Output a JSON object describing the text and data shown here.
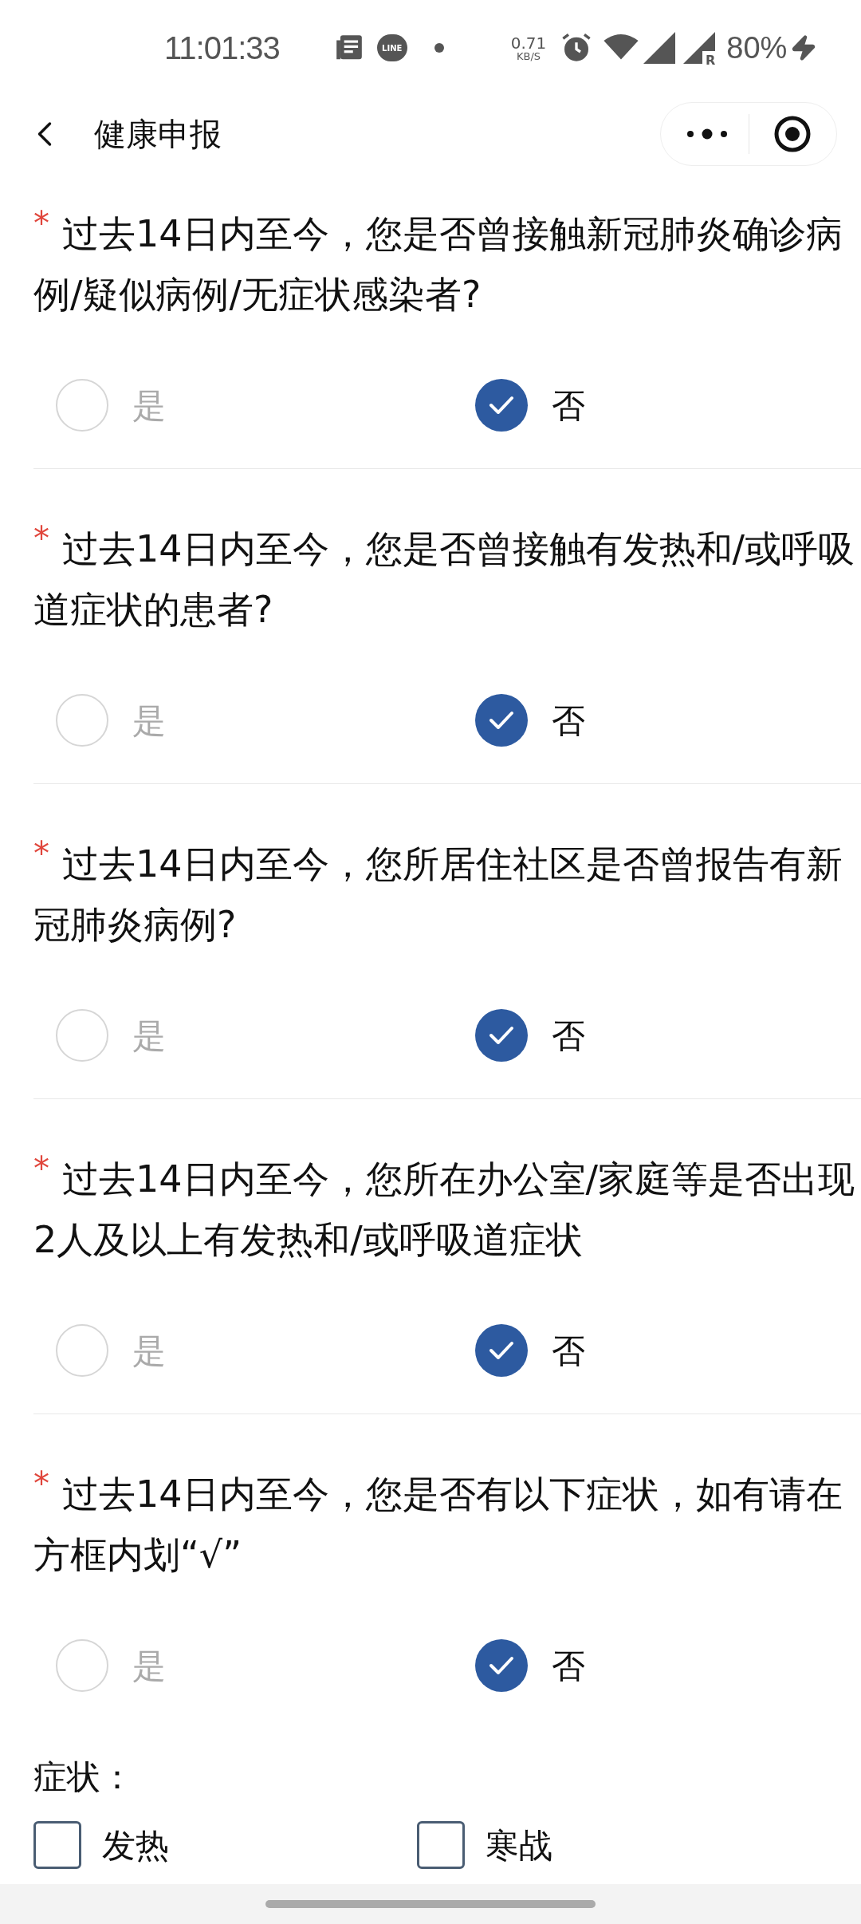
{
  "status_bar": {
    "time": "11:01:33",
    "app_badge": "LINE",
    "speed_value": "0.71",
    "speed_unit": "KB/S",
    "signal_tag": "R",
    "battery": "80%"
  },
  "header": {
    "title": "健康申报"
  },
  "questions": [
    {
      "required_mark": "*",
      "text": "过去14日内至今，您是否曾接触新冠肺炎确诊病例/疑似病例/无症状感染者?",
      "options": [
        {
          "label": "是",
          "selected": false
        },
        {
          "label": "否",
          "selected": true
        }
      ]
    },
    {
      "required_mark": "*",
      "text": "过去14日内至今，您是否曾接触有发热和/或呼吸道症状的患者?",
      "options": [
        {
          "label": "是",
          "selected": false
        },
        {
          "label": "否",
          "selected": true
        }
      ]
    },
    {
      "required_mark": "*",
      "text": "过去14日内至今，您所居住社区是否曾报告有新冠肺炎病例?",
      "options": [
        {
          "label": "是",
          "selected": false
        },
        {
          "label": "否",
          "selected": true
        }
      ]
    },
    {
      "required_mark": "*",
      "text": "过去14日内至今，您所在办公室/家庭等是否出现2人及以上有发热和/或呼吸道症状",
      "options": [
        {
          "label": "是",
          "selected": false
        },
        {
          "label": "否",
          "selected": true
        }
      ]
    },
    {
      "required_mark": "*",
      "text": "过去14日内至今，您是否有以下症状，如有请在方框内划“√”",
      "options": [
        {
          "label": "是",
          "selected": false
        },
        {
          "label": "否",
          "selected": true
        }
      ]
    }
  ],
  "symptoms": {
    "label": "症状：",
    "items": [
      {
        "label": "发热",
        "checked": false
      },
      {
        "label": "寒战",
        "checked": false
      }
    ]
  }
}
